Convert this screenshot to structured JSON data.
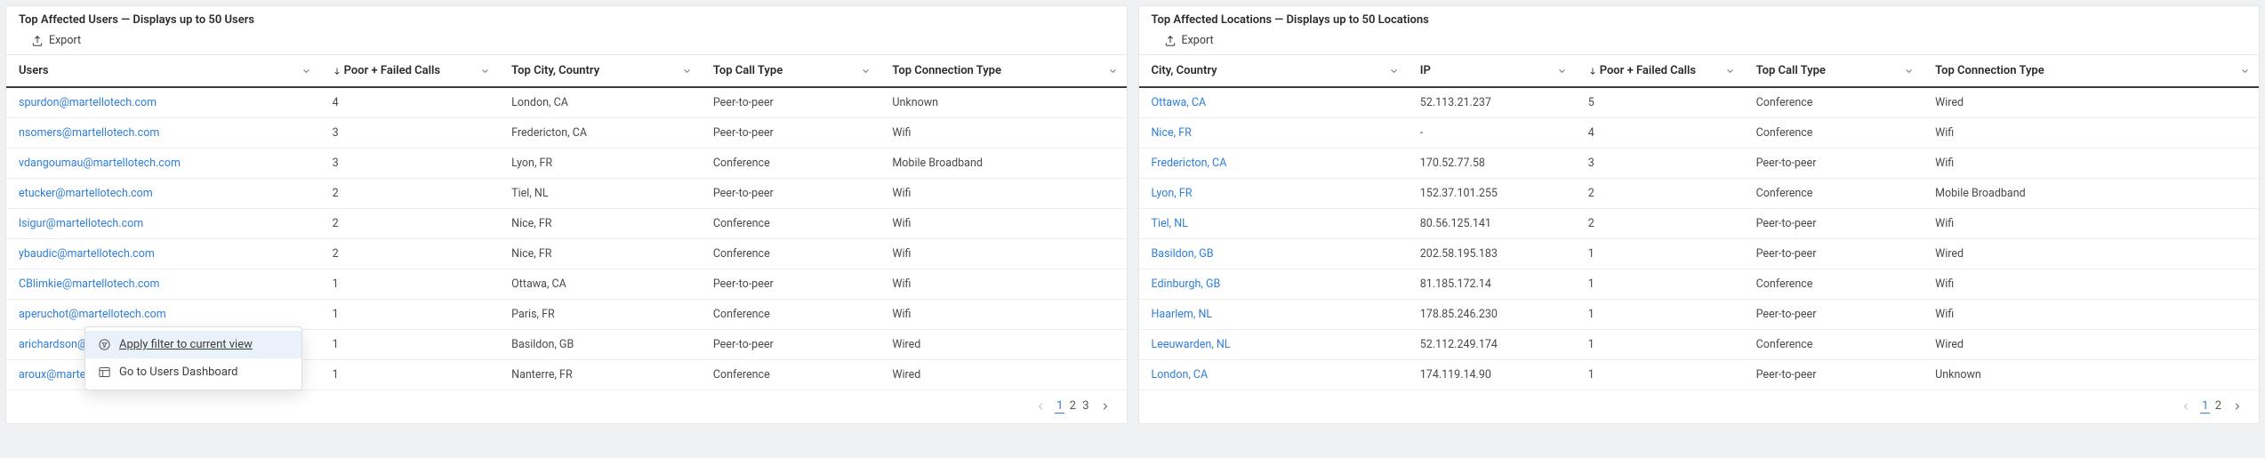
{
  "left": {
    "title": "Top Affected Users — Displays up to 50 Users",
    "export_label": "Export",
    "columns": [
      "Users",
      "Poor + Failed Calls",
      "Top City, Country",
      "Top Call Type",
      "Top Connection Type"
    ],
    "rows": [
      {
        "user": "spurdon@martellotech.com",
        "calls": "4",
        "city": "London, CA",
        "calltype": "Peer-to-peer",
        "conn": "Unknown"
      },
      {
        "user": "nsomers@martellotech.com",
        "calls": "3",
        "city": "Fredericton, CA",
        "calltype": "Peer-to-peer",
        "conn": "Wifi"
      },
      {
        "user": "vdangoumau@martellotech.com",
        "calls": "3",
        "city": "Lyon, FR",
        "calltype": "Conference",
        "conn": "Mobile Broadband"
      },
      {
        "user": "etucker@martellotech.com",
        "calls": "2",
        "city": "Tiel, NL",
        "calltype": "Peer-to-peer",
        "conn": "Wifi"
      },
      {
        "user": "lsigur@martellotech.com",
        "calls": "2",
        "city": "Nice, FR",
        "calltype": "Conference",
        "conn": "Wifi"
      },
      {
        "user": "ybaudic@martellotech.com",
        "calls": "2",
        "city": "Nice, FR",
        "calltype": "Conference",
        "conn": "Wifi"
      },
      {
        "user": "CBlimkie@martellotech.com",
        "calls": "1",
        "city": "Ottawa, CA",
        "calltype": "Peer-to-peer",
        "conn": "Wifi"
      },
      {
        "user": "aperuchot@martellotech.com",
        "calls": "1",
        "city": "Paris, FR",
        "calltype": "Conference",
        "conn": "Wifi"
      },
      {
        "user": "arichardson@martellotech.com",
        "calls": "1",
        "city": "Basildon, GB",
        "calltype": "Peer-to-peer",
        "conn": "Wired"
      },
      {
        "user": "aroux@martellotech.com",
        "calls": "1",
        "city": "Nanterre, FR",
        "calltype": "Conference",
        "conn": "Wired"
      }
    ],
    "pager": [
      "1",
      "2",
      "3"
    ]
  },
  "right": {
    "title": "Top Affected Locations — Displays up to 50 Locations",
    "export_label": "Export",
    "columns": [
      "City, Country",
      "IP",
      "Poor + Failed Calls",
      "Top Call Type",
      "Top Connection Type"
    ],
    "rows": [
      {
        "city": "Ottawa, CA",
        "ip": "52.113.21.237",
        "calls": "5",
        "calltype": "Conference",
        "conn": "Wired"
      },
      {
        "city": "Nice, FR",
        "ip": "-",
        "calls": "4",
        "calltype": "Conference",
        "conn": "Wifi"
      },
      {
        "city": "Fredericton, CA",
        "ip": "170.52.77.58",
        "calls": "3",
        "calltype": "Peer-to-peer",
        "conn": "Wifi"
      },
      {
        "city": "Lyon, FR",
        "ip": "152.37.101.255",
        "calls": "2",
        "calltype": "Conference",
        "conn": "Mobile Broadband"
      },
      {
        "city": "Tiel, NL",
        "ip": "80.56.125.141",
        "calls": "2",
        "calltype": "Peer-to-peer",
        "conn": "Wifi"
      },
      {
        "city": "Basildon, GB",
        "ip": "202.58.195.183",
        "calls": "1",
        "calltype": "Peer-to-peer",
        "conn": "Wired"
      },
      {
        "city": "Edinburgh, GB",
        "ip": "81.185.172.14",
        "calls": "1",
        "calltype": "Conference",
        "conn": "Wifi"
      },
      {
        "city": "Haarlem, NL",
        "ip": "178.85.246.230",
        "calls": "1",
        "calltype": "Peer-to-peer",
        "conn": "Wifi"
      },
      {
        "city": "Leeuwarden, NL",
        "ip": "52.112.249.174",
        "calls": "1",
        "calltype": "Conference",
        "conn": "Wired"
      },
      {
        "city": "London, CA",
        "ip": "174.119.14.90",
        "calls": "1",
        "calltype": "Peer-to-peer",
        "conn": "Unknown"
      }
    ],
    "pager": [
      "1",
      "2"
    ]
  },
  "ctx": {
    "item1": "Apply filter to current view",
    "item2": "Go to Users Dashboard"
  }
}
